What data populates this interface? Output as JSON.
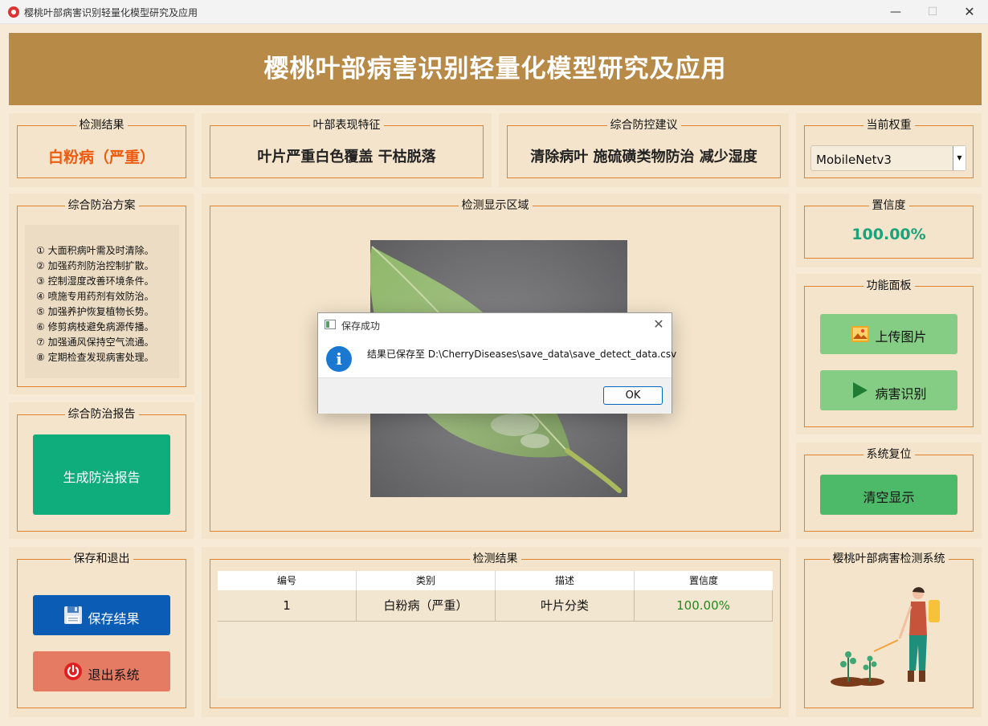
{
  "window": {
    "title": "樱桃叶部病害识别轻量化模型研究及应用",
    "minimize_glyph": "—",
    "maximize_glyph": "☐",
    "close_glyph": "✕"
  },
  "header": {
    "title": "樱桃叶部病害识别轻量化模型研究及应用"
  },
  "detect_result": {
    "title": "检测结果",
    "value": "白粉病（严重）",
    "value_color": "#ee5a0e"
  },
  "leaf_feature": {
    "title": "叶部表现特征",
    "value": "叶片严重白色覆盖 干枯脱落"
  },
  "advice": {
    "title": "综合防控建议",
    "value": "清除病叶 施硫磺类物防治 减少湿度"
  },
  "weights": {
    "title": "当前权重",
    "selected": "MobileNetv3"
  },
  "plan": {
    "title": "综合防治方案",
    "items": [
      "① 大面积病叶需及时清除。",
      "② 加强药剂防治控制扩散。",
      "③ 控制湿度改善环境条件。",
      "④ 喷施专用药剂有效防治。",
      "⑤ 加强养护恢复植物长势。",
      "⑥ 修剪病枝避免病源传播。",
      "⑦ 加强通风保持空气流通。",
      "⑧ 定期检查发现病害处理。"
    ]
  },
  "display": {
    "title": "检测显示区域"
  },
  "confidence": {
    "title": "置信度",
    "value": "100.00%",
    "color": "#1aa37a"
  },
  "functions": {
    "title": "功能面板",
    "upload_label": "上传图片",
    "identify_label": "病害识别",
    "button_color": "#85cc85"
  },
  "reset": {
    "title": "系统复位",
    "clear_label": "清空显示",
    "button_color": "#4dba6a"
  },
  "report": {
    "title": "综合防治报告",
    "generate_label": "生成防治报告",
    "button_color": "#0fad7c"
  },
  "save_exit": {
    "title": "保存和退出",
    "save_label": "保存结果",
    "exit_label": "退出系统",
    "save_color": "#0b5cb5",
    "exit_color": "#e57b63"
  },
  "results_table": {
    "title": "检测结果",
    "columns": [
      "编号",
      "类别",
      "描述",
      "置信度"
    ],
    "rows": [
      {
        "id": "1",
        "category": "白粉病（严重）",
        "description": "叶片分类",
        "confidence": "100.00%"
      }
    ],
    "confidence_color": "#1d8a1d"
  },
  "system": {
    "title": "樱桃叶部病害检测系统"
  },
  "dialog": {
    "title": "保存成功",
    "message": "结果已保存至 D:\\CherryDiseases\\save_data\\save_detect_data.csv",
    "ok_label": "OK",
    "info_glyph": "i",
    "close_glyph": "✕"
  },
  "icons": {
    "app": "cherry-app-icon",
    "upload": "image-icon",
    "identify": "play-icon",
    "save": "floppy-disk-icon",
    "exit": "power-icon",
    "dialog": "window-icon",
    "info": "info-icon"
  }
}
